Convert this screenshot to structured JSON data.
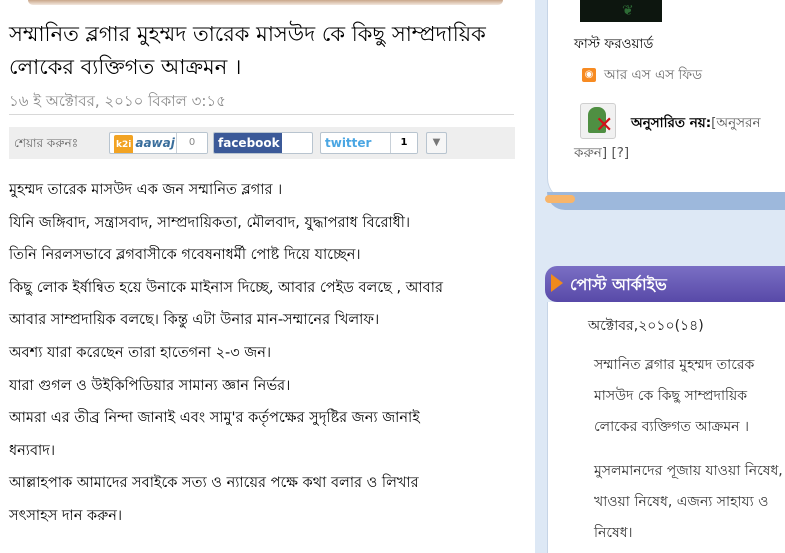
{
  "post": {
    "title": "সম্মানিত ব্লগার মুহম্মদ তারেক মাসউদ কে কিছু সাম্প্রদায়িক লোকের ব্যক্তিগত আক্রমন ।",
    "date": "১৬ ই অক্টোবর, ২০১০ বিকাল ৩:১৫",
    "share": {
      "label": "শেয়ার করুনঃ",
      "aawaj": {
        "logo": "k2i",
        "name": "aawaj",
        "count": "0"
      },
      "facebook": {
        "name": "facebook"
      },
      "twitter": {
        "name": "twitter",
        "count": "1"
      },
      "more_icon": "chevron-down-icon"
    },
    "body_lines": [
      "মুহম্মদ তারেক মাসউদ এক জন সম্মানিত ব্লগার ।",
      "যিনি জঙ্গিবাদ, সন্ত্রাসবাদ, সাম্প্রদায়িকতা, মৌলবাদ, যুদ্ধাপরাধ বিরোধী।",
      "তিনি নিরলসভাবে ব্লগবাসীকে গবেষনাধর্মী পোষ্ট দিয়ে যাচ্ছেন।",
      "কিছু লোক ইর্ষান্বিত হয়ে উনাকে মাইনাস দিচ্ছে, আবার পেইড বলছে , আবার",
      "আবার সাম্প্রদায়িক বলছে। কিন্তু এটা উনার মান-সম্মানের খিলাফ।",
      "অবশ্য যারা করেছেন তারা হাতেগনা ২-৩ জন।",
      "যারা গুগল ও উইকিপিডিয়ার সামান্য জ্ঞান নির্ভর।",
      "আমরা এর তীব্র নিন্দা জানাই এবং সামু'র কর্তৃপক্ষের সুদৃষ্টির জন্য জানাই",
      "ধন্যবাদ।",
      "আল্লাহপাক আমাদের সবাইকে সত্য ও ন্যায়ের পক্ষে কথা বলার ও লিখার",
      "সৎসাহস দান করুন।"
    ]
  },
  "sidebar": {
    "fast_forward": "ফাস্ট ফরওয়ার্ড",
    "rss": "আর এস এস ফিড",
    "follow": {
      "status": "অনুসারিত নয়:",
      "action": "[অনুসরন করুন]",
      "help": "[?]"
    },
    "archive": {
      "heading": "পোস্ট আর্কাইভ",
      "month": "অক্টোবর,২০১০(১৪)",
      "posts": [
        "সম্মানিত ব্লগার মুহম্মদ তারেক মাসউদ কে কিছু সাম্প্রদায়িক লোকের ব্যক্তিগত আক্রমন ।",
        "মুসলমানদের পূজায় যাওয়া নিষেধ, খাওয়া নিষেধ, এজন্য সাহায্য ও নিষেধ।"
      ]
    }
  },
  "colors": {
    "archive_header": "#5849a8",
    "sidebar_bg": "#dde8f5",
    "date_gray": "#8a8a8a",
    "facebook_blue": "#3b5998",
    "twitter_blue": "#4aa6e3"
  }
}
